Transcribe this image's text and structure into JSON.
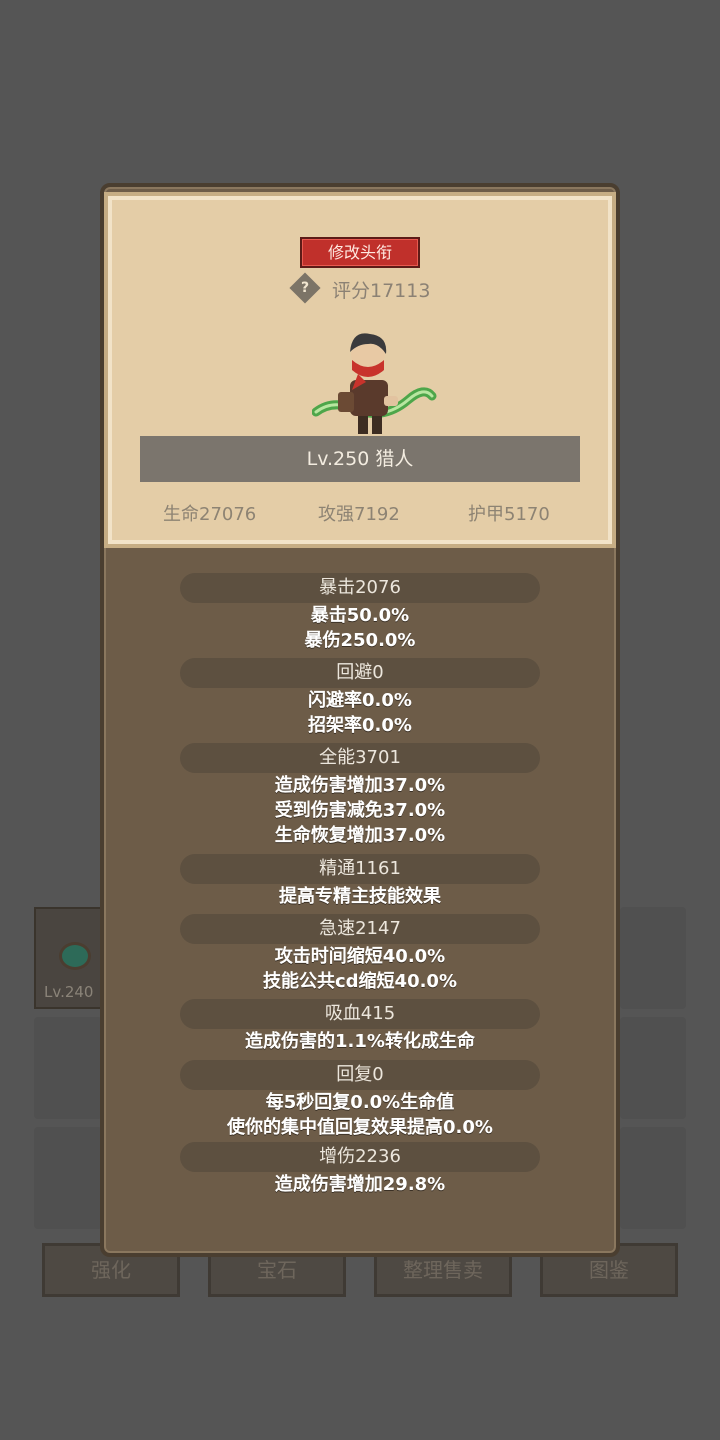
{
  "header": {
    "title_button": "修改头衔",
    "help_icon": "?",
    "score": "评分17113",
    "level_class": "Lv.250 猎人"
  },
  "base_stats": [
    {
      "label": "生命27076"
    },
    {
      "label": "攻强7192"
    },
    {
      "label": "护甲5170"
    }
  ],
  "sections": [
    {
      "title": "暴击2076",
      "lines": [
        "暴击50.0%",
        "暴伤250.0%"
      ]
    },
    {
      "title": "回避0",
      "lines": [
        "闪避率0.0%",
        "招架率0.0%"
      ]
    },
    {
      "title": "全能3701",
      "lines": [
        "造成伤害增加37.0%",
        "受到伤害减免37.0%",
        "生命恢复增加37.0%"
      ]
    },
    {
      "title": "精通1161",
      "lines": [
        "提高专精主技能效果"
      ]
    },
    {
      "title": "急速2147",
      "lines": [
        "攻击时间缩短40.0%",
        "技能公共cd缩短40.0%"
      ]
    },
    {
      "title": "吸血415",
      "lines": [
        "造成伤害的1.1%转化成生命"
      ]
    },
    {
      "title": "回复0",
      "lines": [
        "每5秒回复0.0%生命值",
        "使你的集中值回复效果提高0.0%"
      ]
    },
    {
      "title": "增伤2236",
      "lines": [
        "造成伤害增加29.8%"
      ]
    }
  ],
  "background": {
    "item_level": "Lv.240",
    "buttons": [
      "强化",
      "宝石",
      "整理售卖",
      "图鉴"
    ]
  },
  "colors": {
    "title_button": "#c0302b",
    "panel": "#6d5c48",
    "card": "#e4cda7"
  }
}
